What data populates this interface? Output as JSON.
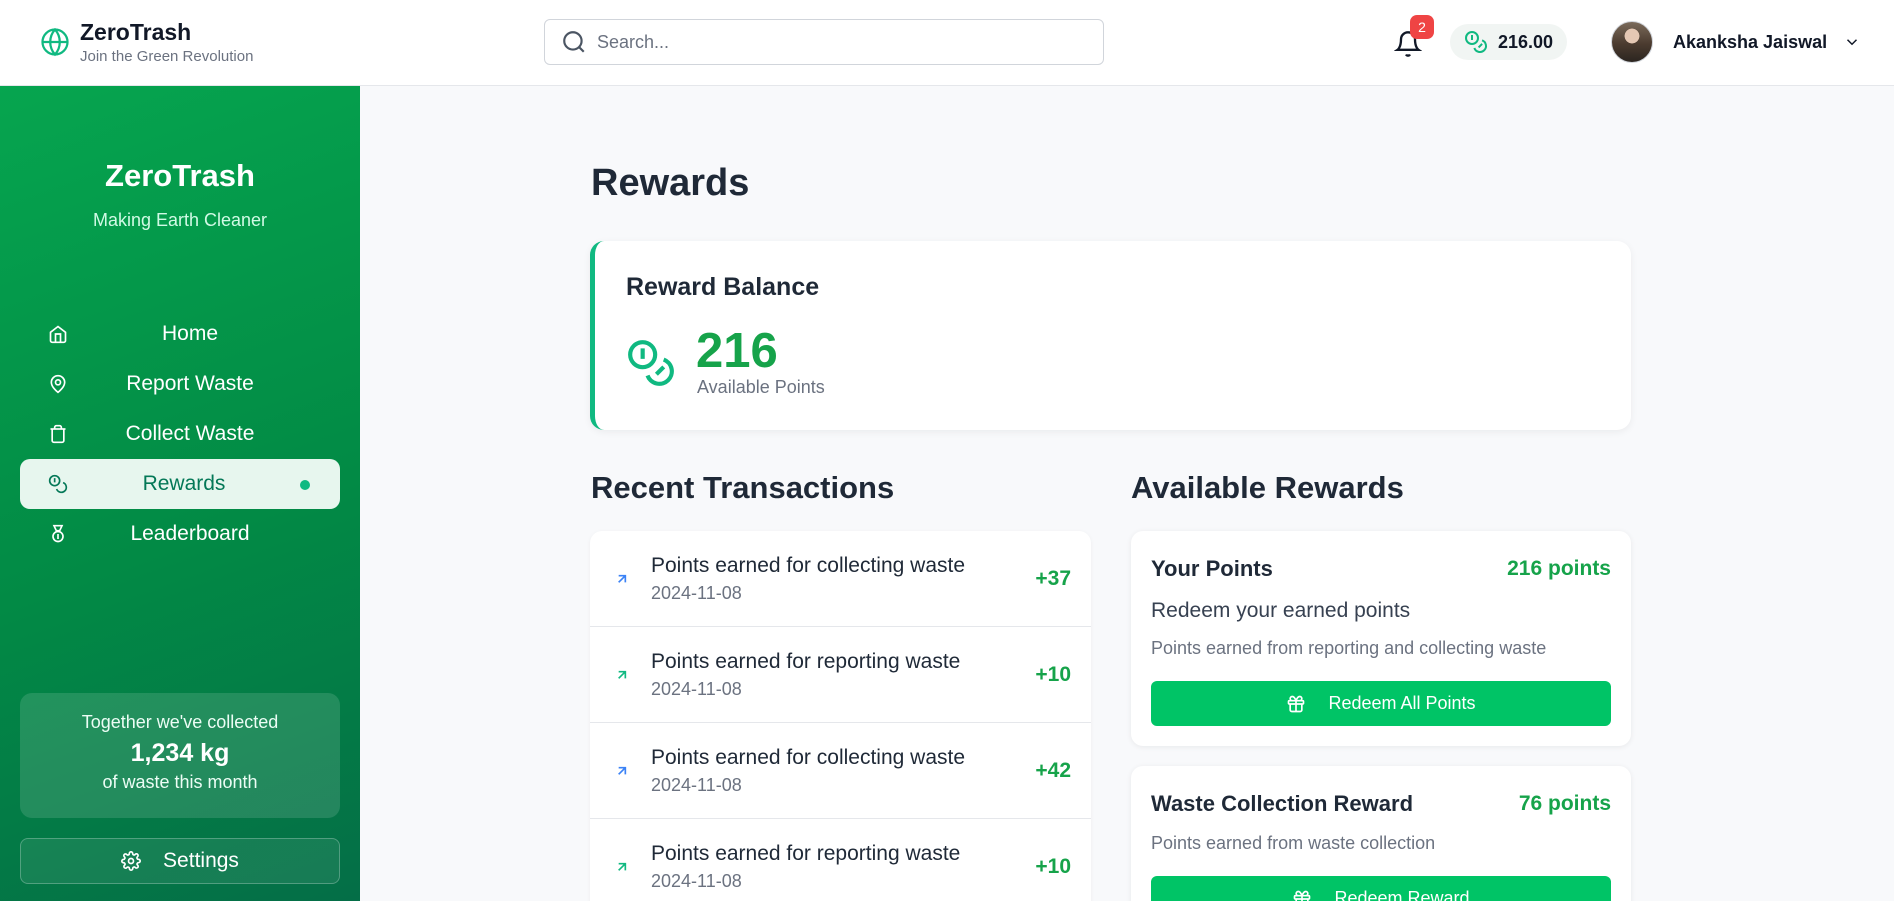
{
  "header": {
    "brand_title": "ZeroTrash",
    "brand_tagline": "Join the Green Revolution",
    "search_placeholder": "Search...",
    "notification_count": "2",
    "balance": "216.00",
    "user_name": "Akanksha Jaiswal"
  },
  "sidebar": {
    "title": "ZeroTrash",
    "subtitle": "Making Earth Cleaner",
    "items": [
      {
        "label": "Home",
        "icon": "home-icon"
      },
      {
        "label": "Report Waste",
        "icon": "map-pin-icon"
      },
      {
        "label": "Collect Waste",
        "icon": "trash-icon"
      },
      {
        "label": "Rewards",
        "icon": "coins-icon",
        "active": true
      },
      {
        "label": "Leaderboard",
        "icon": "medal-icon"
      }
    ],
    "stats": {
      "line1": "Together we've collected",
      "value": "1,234 kg",
      "line3": "of waste this month"
    },
    "settings_label": "Settings"
  },
  "main": {
    "title": "Rewards",
    "balance_card": {
      "title": "Reward Balance",
      "value": "216",
      "label": "Available Points"
    },
    "transactions_title": "Recent Transactions",
    "transactions": [
      {
        "description": "Points earned for collecting waste",
        "date": "2024-11-08",
        "amount": "+37",
        "type": "collect"
      },
      {
        "description": "Points earned for reporting waste",
        "date": "2024-11-08",
        "amount": "+10",
        "type": "report"
      },
      {
        "description": "Points earned for collecting waste",
        "date": "2024-11-08",
        "amount": "+42",
        "type": "collect"
      },
      {
        "description": "Points earned for reporting waste",
        "date": "2024-11-08",
        "amount": "+10",
        "type": "report"
      }
    ],
    "rewards_title": "Available Rewards",
    "rewards": [
      {
        "title": "Your Points",
        "points": "216 points",
        "subtitle": "Redeem your earned points",
        "description": "Points earned from reporting and collecting waste",
        "button": "Redeem All Points"
      },
      {
        "title": "Waste Collection Reward",
        "points": "76 points",
        "description": "Points earned from waste collection",
        "button": "Redeem Reward"
      }
    ]
  },
  "colors": {
    "accent": "#00c466",
    "sidebar_start": "#06a54f",
    "sidebar_end": "#046e47",
    "points_text": "#16a34a",
    "badge": "#ef4444"
  }
}
